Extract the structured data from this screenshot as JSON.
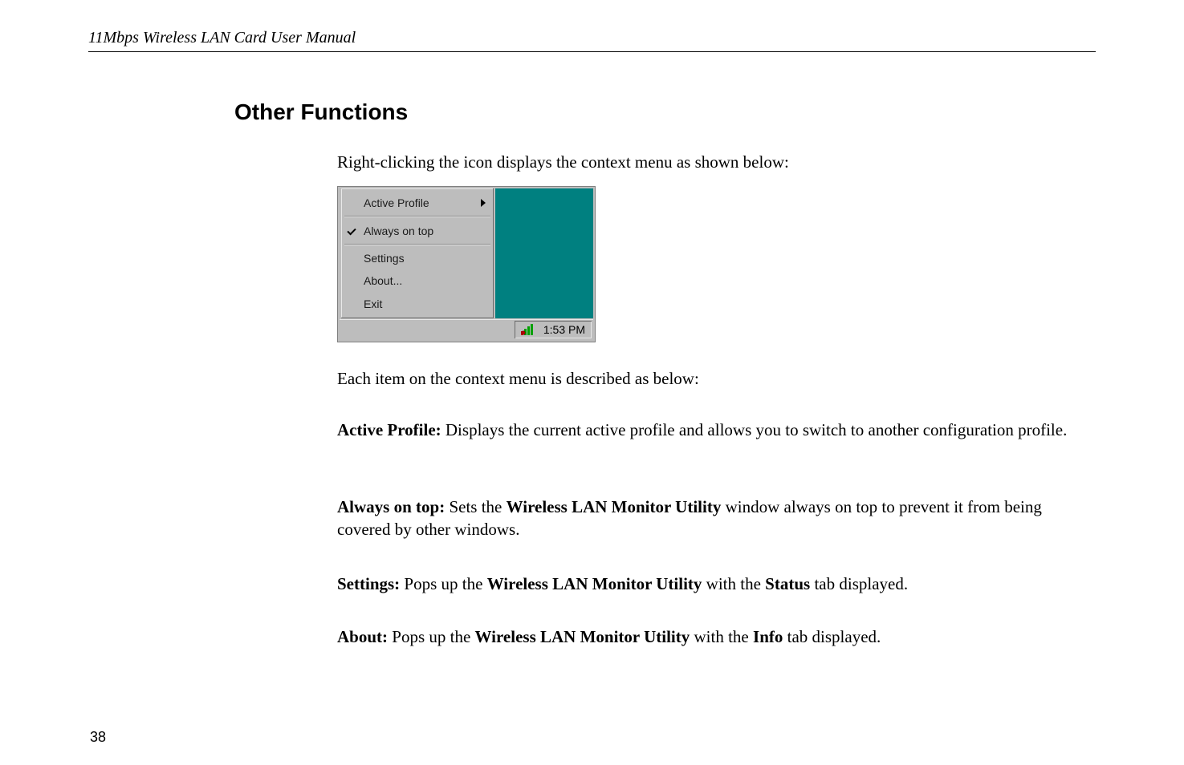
{
  "header": {
    "running_head": "11Mbps Wireless LAN Card User Manual"
  },
  "section": {
    "heading": "Other Functions",
    "intro": "Right-clicking the icon displays the context menu as shown below:",
    "desc": "Each item on the context menu is described as below:"
  },
  "paragraphs": {
    "active_profile": {
      "label": "Active Profile:",
      "text": " Displays the current active profile and allows you to switch to another configuration profile."
    },
    "always_on_top": {
      "label": "Always on top:",
      "pre": " Sets the ",
      "bold1": "Wireless LAN Monitor Utility",
      "post": " window always on top to prevent it from being covered by other windows."
    },
    "settings": {
      "label": "Settings:",
      "pre": " Pops up the ",
      "bold1": "Wireless LAN Monitor Utility",
      "mid": " with the ",
      "bold2": "Status",
      "post": " tab displayed."
    },
    "about": {
      "label": "About:",
      "pre": " Pops up the ",
      "bold1": "Wireless LAN Monitor Utility",
      "mid": " with the ",
      "bold2": "Info",
      "post": " tab displayed."
    }
  },
  "figure": {
    "menu": {
      "active_profile": "Active Profile",
      "always_on_top": "Always on top",
      "settings": "Settings",
      "about": "About...",
      "exit": "Exit"
    },
    "tray": {
      "time": "1:53 PM"
    }
  },
  "footer": {
    "page_number": "38"
  }
}
